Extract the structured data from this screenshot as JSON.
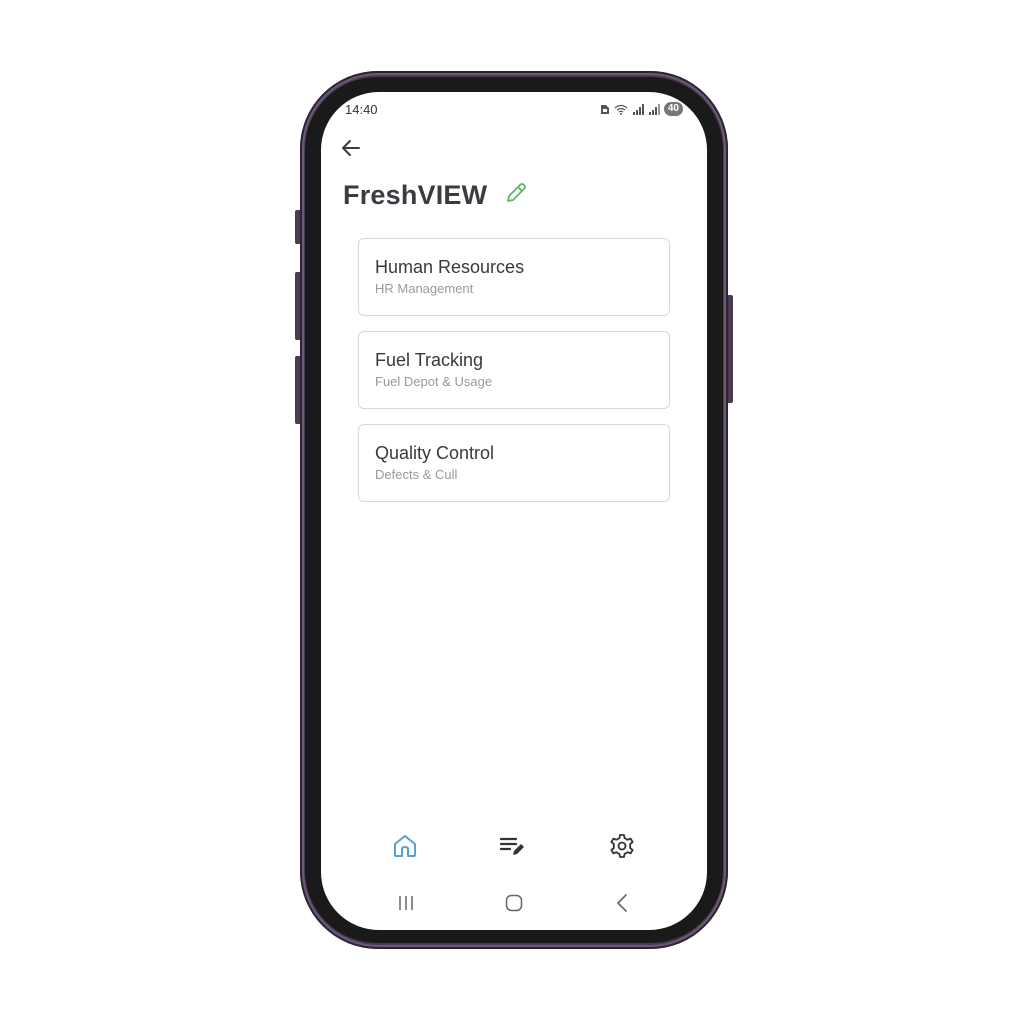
{
  "status_bar": {
    "time": "14:40",
    "battery": "40"
  },
  "header": {
    "title": "FreshVIEW"
  },
  "modules": [
    {
      "title": "Human Resources",
      "subtitle": "HR Management"
    },
    {
      "title": "Fuel Tracking",
      "subtitle": "Fuel Depot & Usage"
    },
    {
      "title": "Quality Control",
      "subtitle": "Defects & Cull"
    }
  ],
  "bottom_nav": {
    "items": [
      {
        "icon": "home-icon",
        "active": true
      },
      {
        "icon": "edit-list-icon",
        "active": false
      },
      {
        "icon": "gear-icon",
        "active": false
      }
    ]
  },
  "colors": {
    "phone_frame": "#4a3a52",
    "accent_green": "#5cb85c",
    "nav_active": "#5a9fd4",
    "text_dark": "#3d3a42",
    "text_muted": "#9a9a9e"
  }
}
